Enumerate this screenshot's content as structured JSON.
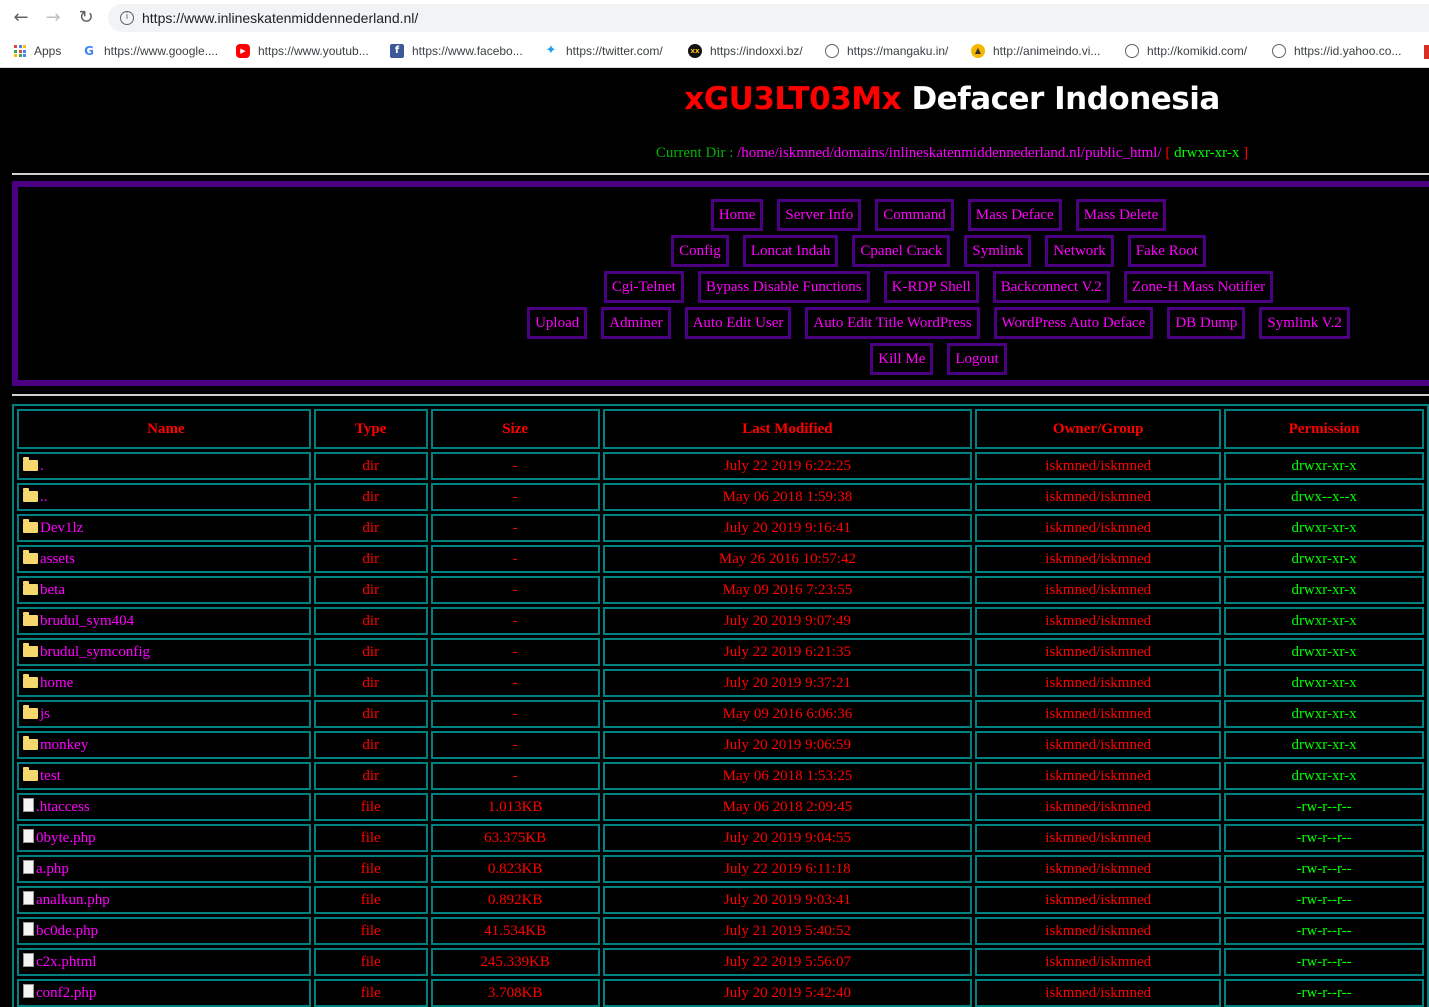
{
  "browser": {
    "url": "https://www.inlineskatenmiddennederland.nl/",
    "bookmarks": [
      {
        "label": "Apps",
        "icon": "apps-grid-icon"
      },
      {
        "label": "https://www.google....",
        "icon": "google-icon"
      },
      {
        "label": "https://www.youtub...",
        "icon": "youtube-icon"
      },
      {
        "label": "https://www.facebo...",
        "icon": "facebook-icon"
      },
      {
        "label": "https://twitter.com/",
        "icon": "twitter-icon"
      },
      {
        "label": "https://indoxxi.bz/",
        "icon": "indoxxi-icon"
      },
      {
        "label": "https://mangaku.in/",
        "icon": "globe-icon"
      },
      {
        "label": "http://animeindo.vi...",
        "icon": "animeindo-icon"
      },
      {
        "label": "http://komikid.com/",
        "icon": "globe-icon"
      },
      {
        "label": "https://id.yahoo.co...",
        "icon": "globe-icon"
      }
    ]
  },
  "header": {
    "title_red": "xGU3LT03Mx",
    "title_white": "Defacer Indonesia",
    "current_dir_label": "Current Dir :",
    "current_dir_path": "/home/iskmned/domains/inlineskatenmiddennederland.nl/public_html/",
    "current_dir_open": "[",
    "current_dir_perm": "drwxr-xr-x",
    "current_dir_close": "]"
  },
  "menu": {
    "rows": [
      [
        "Home",
        "Server Info",
        "Command",
        "Mass Deface",
        "Mass Delete"
      ],
      [
        "Config",
        "Loncat Indah",
        "Cpanel Crack",
        "Symlink",
        "Network",
        "Fake Root"
      ],
      [
        "Cgi-Telnet",
        "Bypass Disable Functions",
        "K-RDP Shell",
        "Backconnect V.2",
        "Zone-H Mass Notifier"
      ],
      [
        "Upload",
        "Adminer",
        "Auto Edit User",
        "Auto Edit Title WordPress",
        "WordPress Auto Deface",
        "DB Dump",
        "Symlink V.2"
      ],
      [
        "Kill Me",
        "Logout"
      ]
    ]
  },
  "table": {
    "headers": {
      "name": "Name",
      "type": "Type",
      "size": "Size",
      "modified": "Last Modified",
      "owner": "Owner/Group",
      "permission": "Permission"
    },
    "rows": [
      {
        "kind": "folder",
        "name": ".",
        "type": "dir",
        "size": "-",
        "modified": "July 22 2019 6:22:25",
        "owner": "iskmned/iskmned",
        "perm": "drwxr-xr-x"
      },
      {
        "kind": "folder",
        "name": "..",
        "type": "dir",
        "size": "-",
        "modified": "May 06 2018 1:59:38",
        "owner": "iskmned/iskmned",
        "perm": "drwx--x--x"
      },
      {
        "kind": "folder",
        "name": "Dev1lz",
        "type": "dir",
        "size": "-",
        "modified": "July 20 2019 9:16:41",
        "owner": "iskmned/iskmned",
        "perm": "drwxr-xr-x"
      },
      {
        "kind": "folder",
        "name": "assets",
        "type": "dir",
        "size": "-",
        "modified": "May 26 2016 10:57:42",
        "owner": "iskmned/iskmned",
        "perm": "drwxr-xr-x"
      },
      {
        "kind": "folder",
        "name": "beta",
        "type": "dir",
        "size": "-",
        "modified": "May 09 2016 7:23:55",
        "owner": "iskmned/iskmned",
        "perm": "drwxr-xr-x"
      },
      {
        "kind": "folder",
        "name": "brudul_sym404",
        "type": "dir",
        "size": "-",
        "modified": "July 20 2019 9:07:49",
        "owner": "iskmned/iskmned",
        "perm": "drwxr-xr-x"
      },
      {
        "kind": "folder",
        "name": "brudul_symconfig",
        "type": "dir",
        "size": "-",
        "modified": "July 22 2019 6:21:35",
        "owner": "iskmned/iskmned",
        "perm": "drwxr-xr-x"
      },
      {
        "kind": "folder",
        "name": "home",
        "type": "dir",
        "size": "-",
        "modified": "July 20 2019 9:37:21",
        "owner": "iskmned/iskmned",
        "perm": "drwxr-xr-x"
      },
      {
        "kind": "folder",
        "name": "js",
        "type": "dir",
        "size": "-",
        "modified": "May 09 2016 6:06:36",
        "owner": "iskmned/iskmned",
        "perm": "drwxr-xr-x"
      },
      {
        "kind": "folder",
        "name": "monkey",
        "type": "dir",
        "size": "-",
        "modified": "July 20 2019 9:06:59",
        "owner": "iskmned/iskmned",
        "perm": "drwxr-xr-x"
      },
      {
        "kind": "folder",
        "name": "test",
        "type": "dir",
        "size": "-",
        "modified": "May 06 2018 1:53:25",
        "owner": "iskmned/iskmned",
        "perm": "drwxr-xr-x"
      },
      {
        "kind": "file",
        "name": ".htaccess",
        "type": "file",
        "size": "1.013KB",
        "modified": "May 06 2018 2:09:45",
        "owner": "iskmned/iskmned",
        "perm": "-rw-r--r--"
      },
      {
        "kind": "file",
        "name": "0byte.php",
        "type": "file",
        "size": "63.375KB",
        "modified": "July 20 2019 9:04:55",
        "owner": "iskmned/iskmned",
        "perm": "-rw-r--r--"
      },
      {
        "kind": "file",
        "name": "a.php",
        "type": "file",
        "size": "0.823KB",
        "modified": "July 22 2019 6:11:18",
        "owner": "iskmned/iskmned",
        "perm": "-rw-r--r--"
      },
      {
        "kind": "file",
        "name": "analkun.php",
        "type": "file",
        "size": "0.892KB",
        "modified": "July 20 2019 9:03:41",
        "owner": "iskmned/iskmned",
        "perm": "-rw-r--r--"
      },
      {
        "kind": "file",
        "name": "bc0de.php",
        "type": "file",
        "size": "41.534KB",
        "modified": "July 21 2019 5:40:52",
        "owner": "iskmned/iskmned",
        "perm": "-rw-r--r--"
      },
      {
        "kind": "file",
        "name": "c2x.phtml",
        "type": "file",
        "size": "245.339KB",
        "modified": "July 22 2019 5:56:07",
        "owner": "iskmned/iskmned",
        "perm": "-rw-r--r--"
      },
      {
        "kind": "file",
        "name": "conf2.php",
        "type": "file",
        "size": "3.708KB",
        "modified": "July 20 2019 5:42:40",
        "owner": "iskmned/iskmned",
        "perm": "-rw-r--r--"
      }
    ]
  }
}
